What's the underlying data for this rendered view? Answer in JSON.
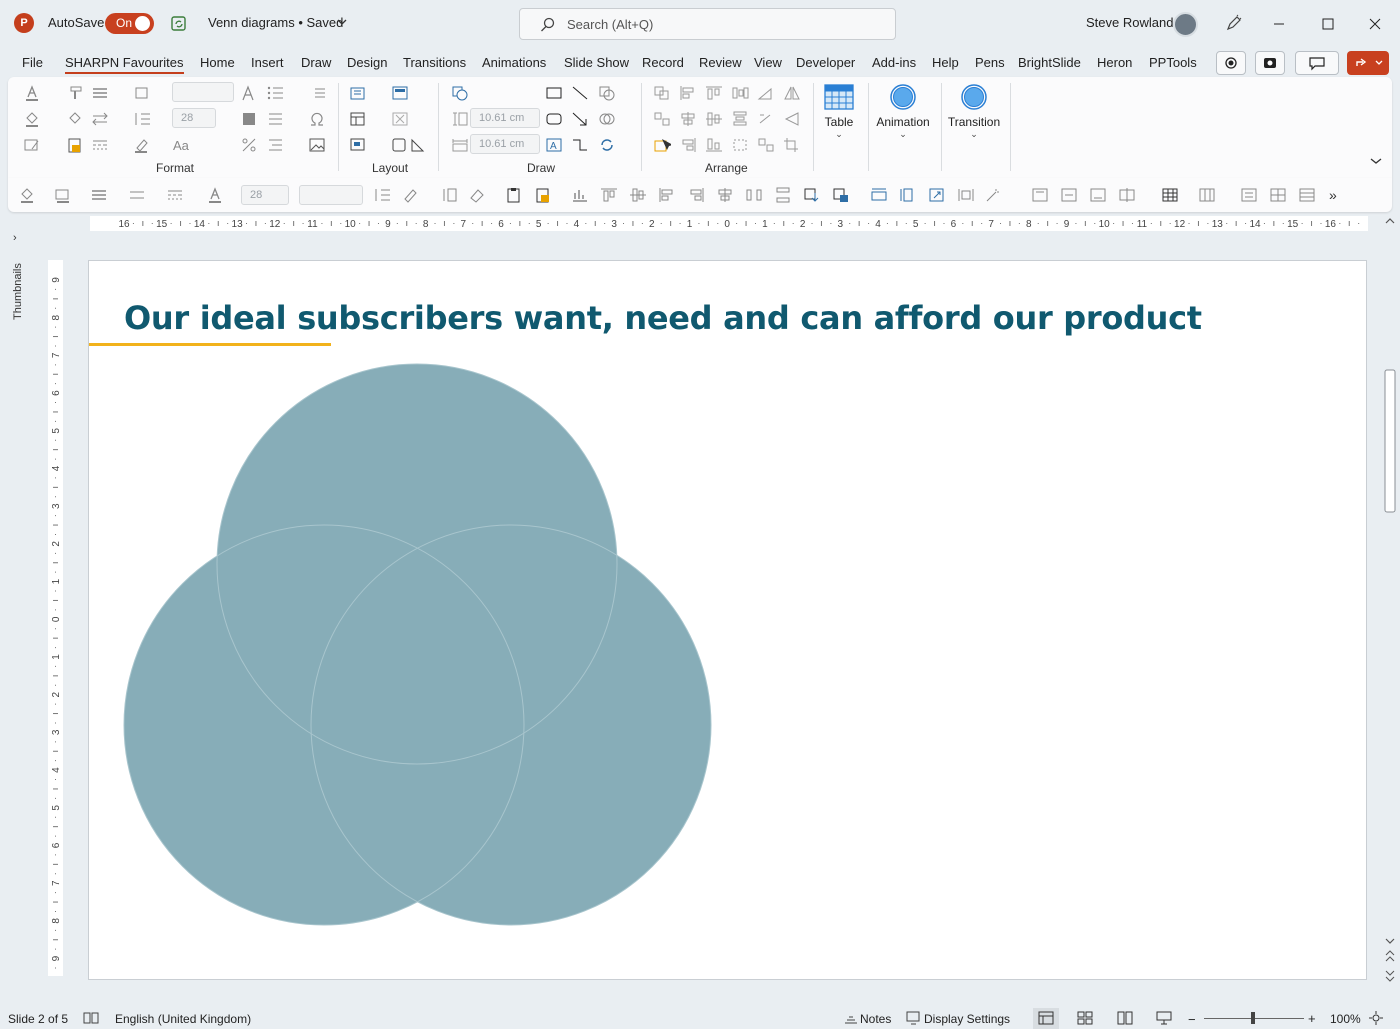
{
  "titlebar": {
    "app_letter": "P",
    "autosave_label": "AutoSave",
    "autosave_state": "On",
    "document_title": "Venn diagrams • Saved",
    "search_placeholder": "Search (Alt+Q)",
    "user_name": "Steve Rowland"
  },
  "tabs": [
    {
      "label": "File"
    },
    {
      "label": "SHARPN Favourites"
    },
    {
      "label": "Home"
    },
    {
      "label": "Insert"
    },
    {
      "label": "Draw"
    },
    {
      "label": "Design"
    },
    {
      "label": "Transitions"
    },
    {
      "label": "Animations"
    },
    {
      "label": "Slide Show"
    },
    {
      "label": "Record"
    },
    {
      "label": "Review"
    },
    {
      "label": "View"
    },
    {
      "label": "Developer"
    },
    {
      "label": "Add-ins"
    },
    {
      "label": "Help"
    },
    {
      "label": "Pens"
    },
    {
      "label": "BrightSlide"
    },
    {
      "label": "Heron"
    },
    {
      "label": "PPTools"
    }
  ],
  "ribbon": {
    "groups": {
      "format": "Format",
      "layout": "Layout",
      "draw": "Draw",
      "arrange": "Arrange"
    },
    "font_size_value": "28",
    "height_value": "10.61 cm",
    "width_value": "10.61 cm",
    "table_label": "Table",
    "animation_label": "Animation",
    "transition_label": "Transition"
  },
  "qat": {
    "font_size_value": "28"
  },
  "rulers": {
    "horizontal_ticks": [
      "16",
      "15",
      "14",
      "13",
      "12",
      "11",
      "10",
      "9",
      "8",
      "7",
      "6",
      "5",
      "4",
      "3",
      "2",
      "1",
      "0",
      "1",
      "2",
      "3",
      "4",
      "5",
      "6",
      "7",
      "8",
      "9",
      "10",
      "11",
      "12",
      "13",
      "14",
      "15",
      "16"
    ],
    "vertical_ticks": [
      "9",
      "8",
      "7",
      "6",
      "5",
      "4",
      "3",
      "2",
      "1",
      "0",
      "1",
      "2",
      "3",
      "4",
      "5",
      "6",
      "7",
      "8",
      "9"
    ]
  },
  "thumbnails_label": "Thumbnails",
  "slide": {
    "title": "Our ideal subscribers want, need and can afford our product",
    "accent_color": "#f2b21b",
    "title_color": "#10596f",
    "circle_fill": "#87adb8"
  },
  "statusbar": {
    "slide_counter": "Slide 2 of 5",
    "language": "English (United Kingdom)",
    "notes_label": "Notes",
    "display_settings_label": "Display Settings",
    "zoom": "100%"
  }
}
